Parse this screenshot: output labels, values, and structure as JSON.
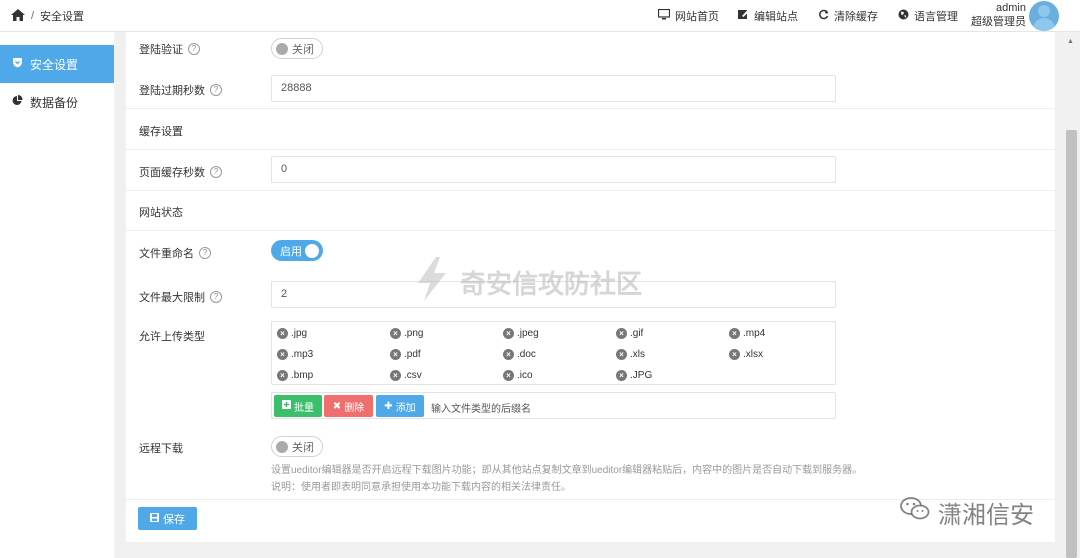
{
  "header": {
    "home_icon": "home-icon",
    "breadcrumb_sep": "/",
    "breadcrumb": "安全设置",
    "nav": [
      {
        "label": "网站首页",
        "icon": "monitor-icon"
      },
      {
        "label": "编辑站点",
        "icon": "edit-icon"
      },
      {
        "label": "清除缓存",
        "icon": "refresh-icon"
      },
      {
        "label": "语言管理",
        "icon": "globe-icon"
      }
    ],
    "user_name": "admin",
    "user_role": "超级管理员"
  },
  "sidebar": {
    "items": [
      {
        "label": "安全设置",
        "icon": "shield-icon",
        "active": true
      },
      {
        "label": "数据备份",
        "icon": "pie-chart-icon",
        "active": false
      }
    ]
  },
  "form": {
    "login_verify": {
      "label": "登陆验证",
      "toggle": "关闭"
    },
    "login_expire": {
      "label": "登陆过期秒数",
      "value": "28888"
    },
    "cache_section": "缓存设置",
    "page_cache": {
      "label": "页面缓存秒数",
      "value": "0"
    },
    "status_section": "网站状态",
    "file_rename": {
      "label": "文件重命名",
      "toggle": "启用"
    },
    "file_max": {
      "label": "文件最大限制",
      "value": "2"
    },
    "upload_types": {
      "label": "允许上传类型",
      "tags": [
        ".jpg",
        ".png",
        ".jpeg",
        ".gif",
        ".mp4",
        ".mp3",
        ".pdf",
        ".doc",
        ".xls",
        ".xlsx",
        ".bmp",
        ".csv",
        ".ico",
        ".JPG"
      ]
    },
    "buttons": {
      "batch": "批量",
      "delete": "删除",
      "add": "添加",
      "input_placeholder": "输入文件类型的后缀名"
    },
    "remote_download": {
      "label": "远程下载",
      "toggle": "关闭",
      "note1": "设置ueditor编辑器是否开启远程下载图片功能；即从其他站点复制文章到ueditor编辑器粘贴后，内容中的图片是否自动下载到服务器。",
      "note2": "说明：使用者即表明同意承担使用本功能下载内容的相关法律责任。"
    },
    "save": "保存"
  },
  "watermarks": {
    "center": "奇安信攻防社区",
    "corner": "潇湘信安"
  },
  "colors": {
    "accent": "#4fa8e8",
    "green": "#3cbf6a",
    "red": "#ef6f6f"
  }
}
